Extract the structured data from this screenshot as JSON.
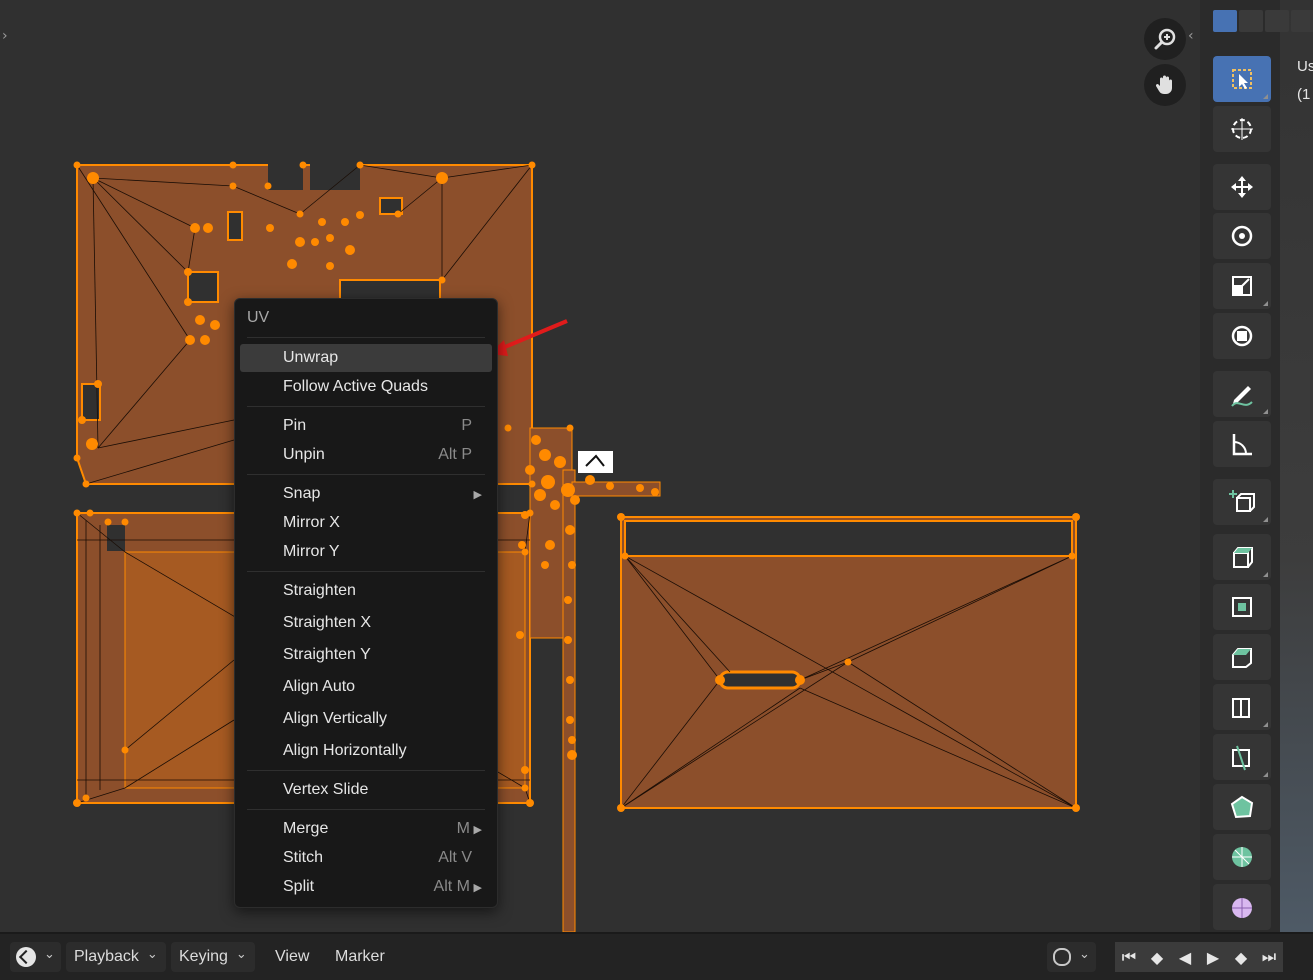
{
  "menu": {
    "title": "UV",
    "items": [
      {
        "label": "Unwrap",
        "shortcut": "",
        "submenu": false
      },
      {
        "label": "Follow Active Quads",
        "shortcut": "",
        "submenu": false
      },
      {
        "label": "Pin",
        "shortcut": "P",
        "submenu": false
      },
      {
        "label": "Unpin",
        "shortcut": "Alt P",
        "submenu": false
      },
      {
        "label": "Snap",
        "shortcut": "",
        "submenu": true
      },
      {
        "label": "Mirror X",
        "shortcut": "",
        "submenu": false
      },
      {
        "label": "Mirror Y",
        "shortcut": "",
        "submenu": false
      },
      {
        "label": "Straighten",
        "shortcut": "",
        "submenu": false
      },
      {
        "label": "Straighten X",
        "shortcut": "",
        "submenu": false
      },
      {
        "label": "Straighten Y",
        "shortcut": "",
        "submenu": false
      },
      {
        "label": "Align Auto",
        "shortcut": "",
        "submenu": false
      },
      {
        "label": "Align Vertically",
        "shortcut": "",
        "submenu": false
      },
      {
        "label": "Align Horizontally",
        "shortcut": "",
        "submenu": false
      },
      {
        "label": "Vertex Slide",
        "shortcut": "",
        "submenu": false
      },
      {
        "label": "Merge",
        "shortcut": "M",
        "submenu": true
      },
      {
        "label": "Stitch",
        "shortcut": "Alt V",
        "submenu": false
      },
      {
        "label": "Split",
        "shortcut": "Alt M",
        "submenu": true
      }
    ],
    "highlighted": "Unwrap"
  },
  "timeline": {
    "editor_icon": "clock-icon",
    "playback": "Playback",
    "keying": "Keying",
    "view": "View",
    "marker": "Marker"
  },
  "sidebar_text": {
    "line1": "Us",
    "line2": "(1"
  },
  "colors": {
    "uv_fill": "#8c4f2b",
    "uv_edge": "#ff8a00",
    "selection_blue": "#4772b3",
    "annotation_arrow": "#e01b1b",
    "viewport_bg": "#303030"
  }
}
